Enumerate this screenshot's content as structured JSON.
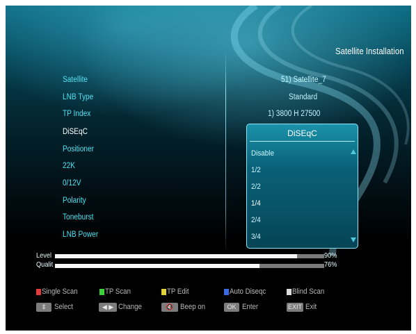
{
  "header": {
    "title": "Satellite Installation"
  },
  "settings": [
    {
      "label": "Satellite",
      "value": "51) Satellite_7"
    },
    {
      "label": "LNB Type",
      "value": "Standard"
    },
    {
      "label": "TP Index",
      "value": "1) 3800 H 27500"
    },
    {
      "label": "DiSEqC",
      "value": ""
    },
    {
      "label": "Positioner",
      "value": ""
    },
    {
      "label": "22K",
      "value": ""
    },
    {
      "label": "0/12V",
      "value": ""
    },
    {
      "label": "Polarity",
      "value": ""
    },
    {
      "label": "Toneburst",
      "value": ""
    },
    {
      "label": "LNB Power",
      "value": ""
    }
  ],
  "popup": {
    "title": "DiSEqC",
    "options": [
      "Disable",
      "1/2",
      "2/2",
      "1/4",
      "2/4",
      "3/4"
    ],
    "selected": "1/4"
  },
  "signal": {
    "level": {
      "label": "Level",
      "percent_text": "90%",
      "fraction": 0.9
    },
    "quality": {
      "label": "Qualit",
      "percent_text": "76%",
      "fraction": 0.76
    }
  },
  "footer": {
    "color_keys": [
      {
        "label": "Single Scan",
        "color": "#e23a3a"
      },
      {
        "label": "TP Scan",
        "color": "#3ad23a"
      },
      {
        "label": "TP Edit",
        "color": "#e2d23a"
      },
      {
        "label": "Auto Diseqc",
        "color": "#3a6ae2"
      },
      {
        "label": "Blind Scan",
        "color": "#dcdcdc"
      }
    ],
    "nav_keys": [
      {
        "key": "⇕",
        "label": "Select"
      },
      {
        "key": "◀ ▶",
        "label": "Change"
      },
      {
        "key": "🔇",
        "label": "Beep on"
      },
      {
        "key": "OK",
        "label": "Enter"
      },
      {
        "key": "EXIT",
        "label": "Exit"
      }
    ]
  }
}
